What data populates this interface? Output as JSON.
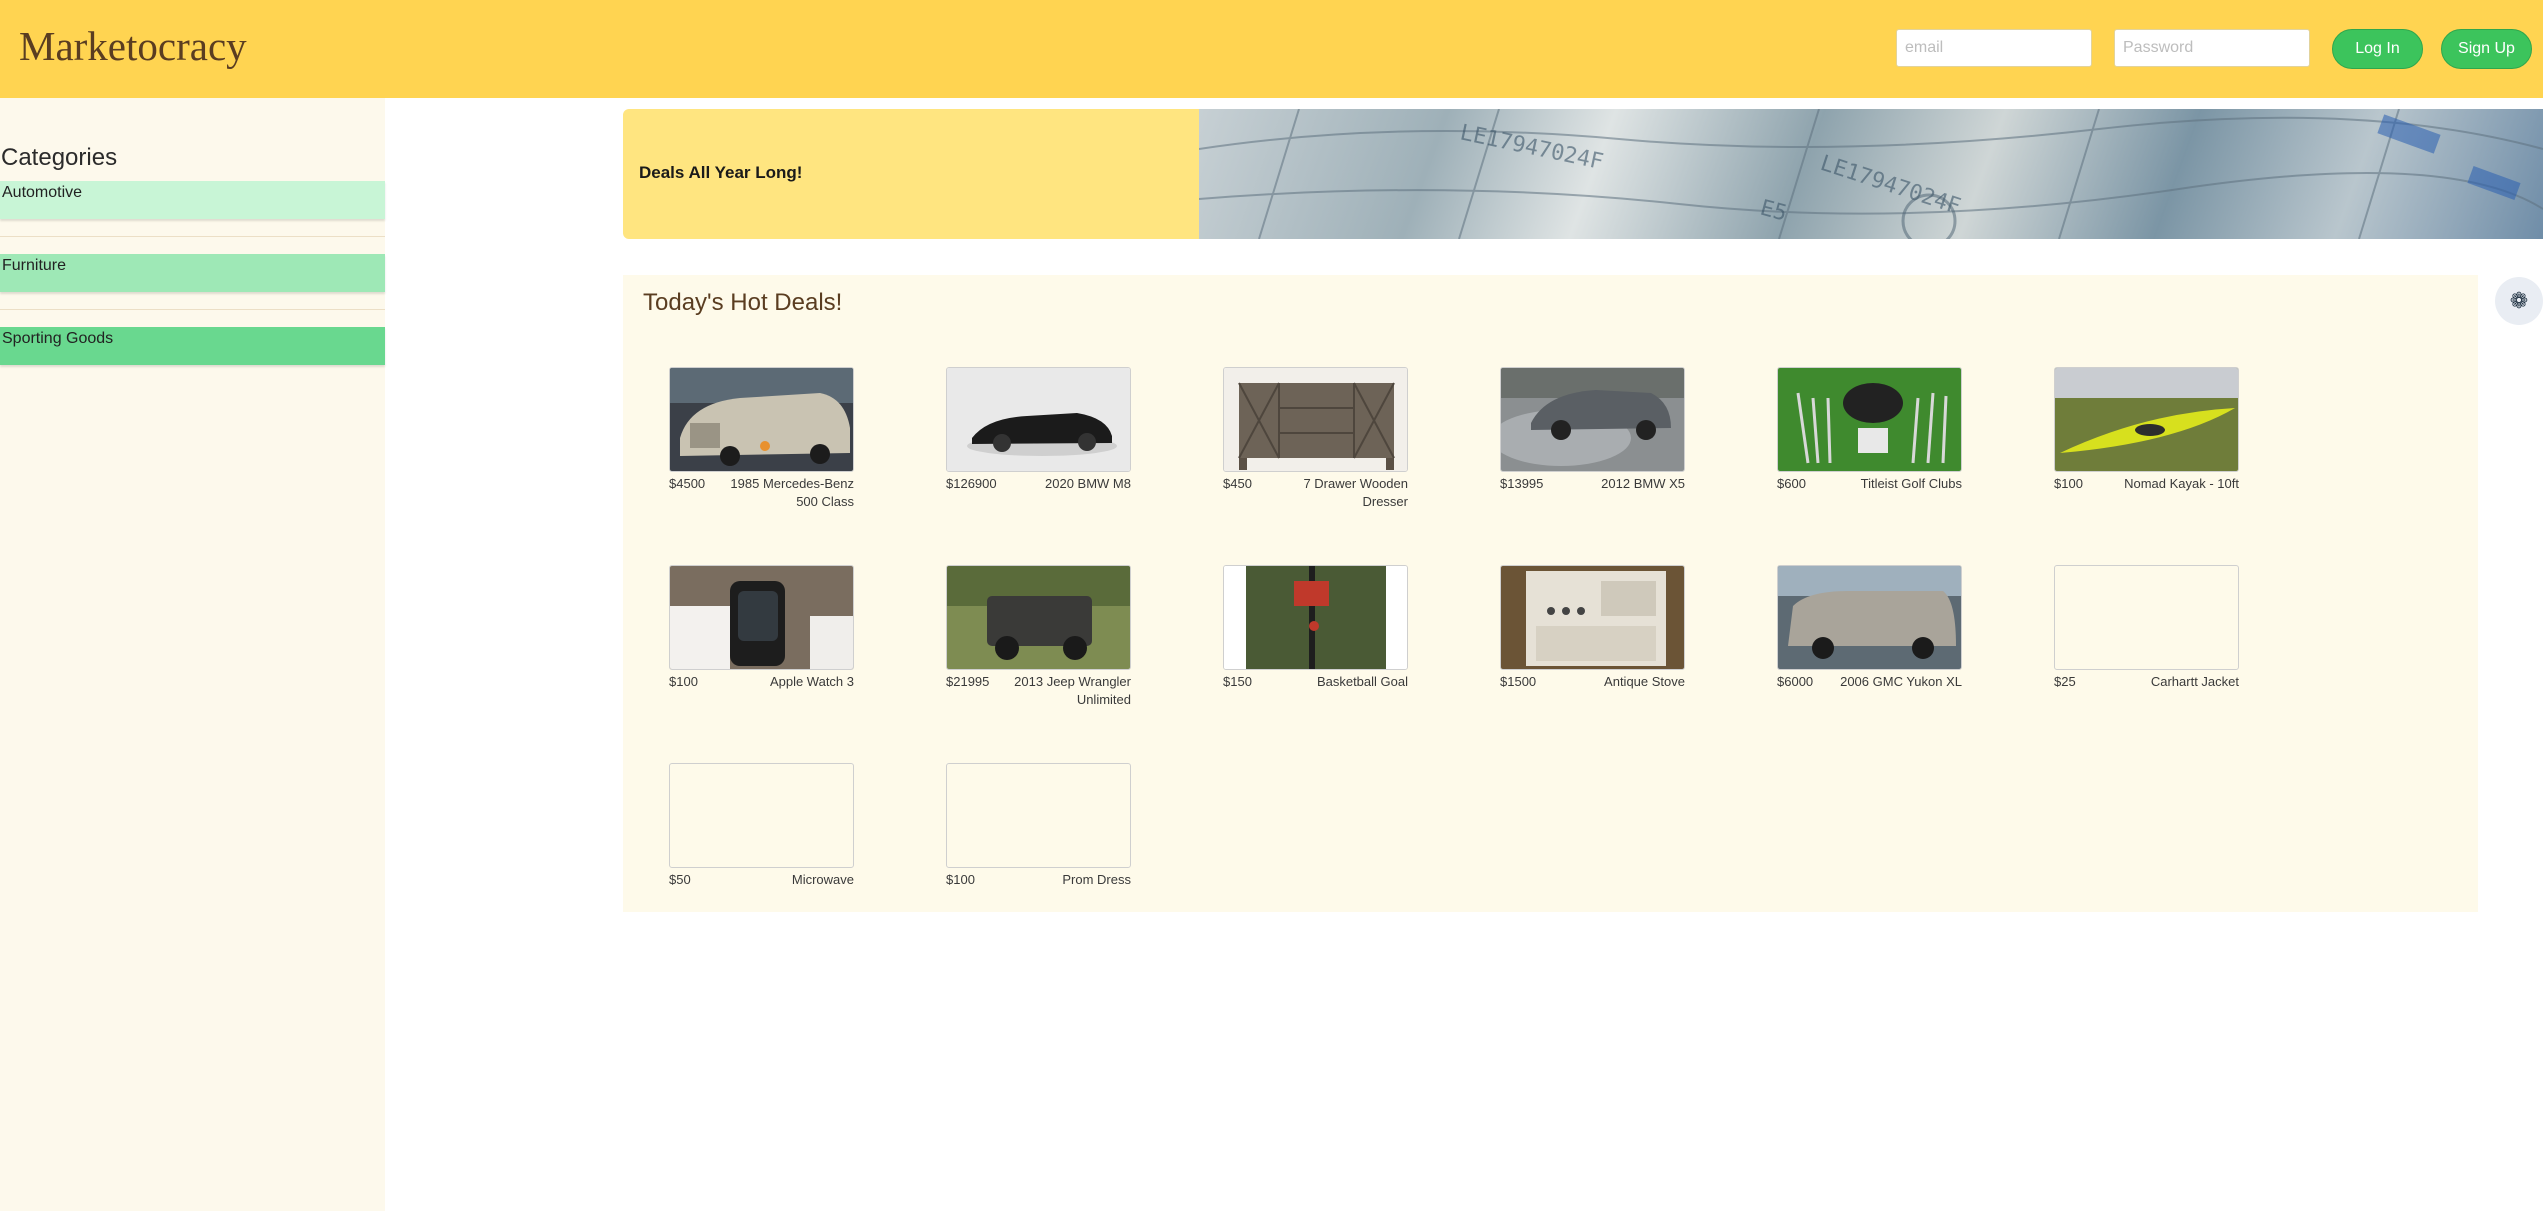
{
  "header": {
    "brand": "Marketocracy",
    "email_placeholder": "email",
    "password_placeholder": "Password",
    "login_label": "Log In",
    "signup_label": "Sign Up"
  },
  "sidebar": {
    "title": "Categories",
    "items": [
      {
        "label": "Automotive",
        "color": "#c8f5d6"
      },
      {
        "label": "Furniture",
        "color": "#9ee8b6"
      },
      {
        "label": "Sporting Goods",
        "color": "#69d88f"
      }
    ]
  },
  "banner": {
    "text": "Deals All Year Long!"
  },
  "deals": {
    "title": "Today's Hot Deals!",
    "items": [
      {
        "price": "$4500",
        "name": "1985 Mercedes-Benz 500 Class"
      },
      {
        "price": "$126900",
        "name": "2020 BMW M8"
      },
      {
        "price": "$450",
        "name": "7 Drawer Wooden Dresser"
      },
      {
        "price": "$13995",
        "name": "2012 BMW X5"
      },
      {
        "price": "$600",
        "name": "Titleist Golf Clubs"
      },
      {
        "price": "$100",
        "name": "Nomad Kayak - 10ft"
      },
      {
        "price": "$100",
        "name": "Apple Watch 3"
      },
      {
        "price": "$21995",
        "name": "2013 Jeep Wrangler Unlimited"
      },
      {
        "price": "$150",
        "name": "Basketball Goal"
      },
      {
        "price": "$1500",
        "name": "Antique Stove"
      },
      {
        "price": "$6000",
        "name": "2006 GMC Yukon XL"
      },
      {
        "price": "$25",
        "name": "Carhartt Jacket"
      },
      {
        "price": "$50",
        "name": "Microwave"
      },
      {
        "price": "$100",
        "name": "Prom Dress"
      }
    ]
  },
  "settings_icon": "gear-icon"
}
